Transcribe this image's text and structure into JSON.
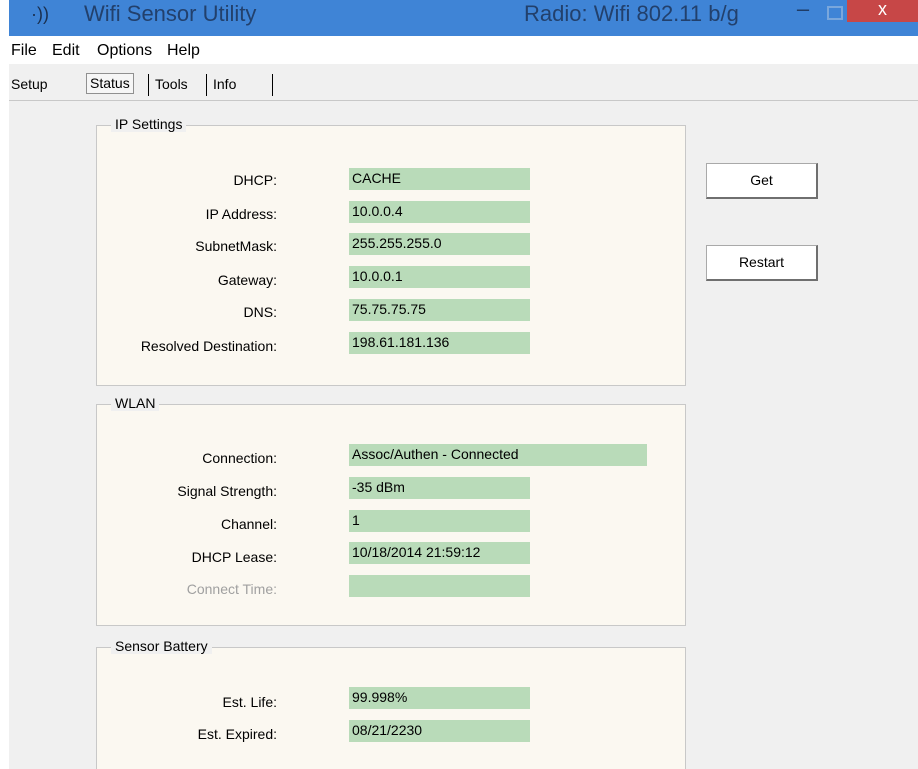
{
  "window": {
    "title": "Wifi Sensor Utility",
    "radio_label": "Radio: Wifi 802.11 b/g",
    "icon": "wifi-signal-icon",
    "controls": {
      "minimize": "–",
      "close": "x"
    }
  },
  "menu": {
    "items": [
      "File",
      "Edit",
      "Options",
      "Help"
    ]
  },
  "tabs": {
    "items": [
      "Setup",
      "Status",
      "Tools",
      "Info"
    ],
    "active": "Status"
  },
  "ip_settings": {
    "title": "IP Settings",
    "fields": [
      {
        "label": "DHCP:",
        "value": "CACHE"
      },
      {
        "label": "IP Address:",
        "value": "10.0.0.4"
      },
      {
        "label": "SubnetMask:",
        "value": "255.255.255.0"
      },
      {
        "label": "Gateway:",
        "value": "10.0.0.1"
      },
      {
        "label": "DNS:",
        "value": "75.75.75.75"
      },
      {
        "label": "Resolved Destination:",
        "value": "198.61.181.136"
      }
    ]
  },
  "wlan": {
    "title": "WLAN",
    "fields": [
      {
        "label": "Connection:",
        "value": "Assoc/Authen - Connected"
      },
      {
        "label": "Signal Strength:",
        "value": "-35 dBm"
      },
      {
        "label": "Channel:",
        "value": "1"
      },
      {
        "label": "DHCP Lease:",
        "value": "10/18/2014 21:59:12"
      },
      {
        "label": "Connect Time:",
        "value": ""
      }
    ]
  },
  "battery": {
    "title": "Sensor Battery",
    "fields": [
      {
        "label": "Est. Life:",
        "value": "99.998%"
      },
      {
        "label": "Est. Expired:",
        "value": "08/21/2230"
      }
    ]
  },
  "buttons": {
    "get": "Get",
    "restart": "Restart"
  },
  "colors": {
    "titlebar": "#3f84d6",
    "value_field": "#b9dbb9",
    "close": "#c74747",
    "group_bg": "#fbf8f1"
  }
}
